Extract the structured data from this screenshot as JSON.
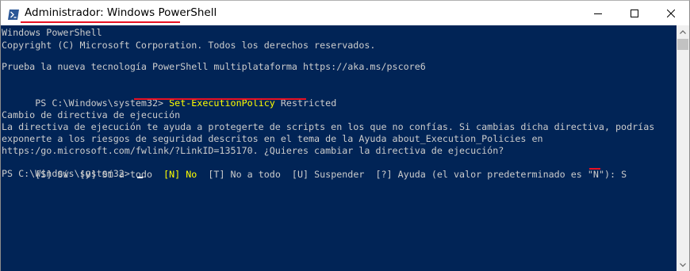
{
  "window": {
    "title": "Administrador: Windows PowerShell",
    "icon": "powershell-icon",
    "controls": [
      "minimize-icon",
      "maximize-icon",
      "close-icon"
    ]
  },
  "console": {
    "lines": [
      "Windows PowerShell",
      "Copyright (C) Microsoft Corporation. Todos los derechos reservados.",
      "",
      "Prueba la nueva tecnología PowerShell multiplataforma https://aka.ms/pscore6",
      "",
      "PS C:\\Windows\\system32> ",
      "",
      "Cambio de directiva de ejecución",
      "La directiva de ejecución te ayuda a protegerte de scripts en los que no confías. Si cambias dicha directiva, podrías",
      "exponerte a los riesgos de seguridad descritos en el tema de la Ayuda about_Execution_Policies en",
      "https:/go.microsoft.com/fwlink/?LinkID=135170. ¿Quieres cambiar la directiva de ejecución?",
      "",
      "PS C:\\Windows\\system32> "
    ],
    "command": {
      "cmdlet": "Set-ExecutionPolicy",
      "argument": " Restricted"
    },
    "choice_prompt": {
      "before": "[S] Sí  [O] Sí a todo  ",
      "highlighted": "[N] No",
      "after": "  [T] No a todo  [U] Suspender  [?] Ayuda (el valor predeterminado es \"N\"): ",
      "answer": "S"
    }
  },
  "colors": {
    "console_background": "#012456",
    "console_text": "#cccccc",
    "highlight_text": "#ffff00",
    "annotation_red": "#e81123"
  }
}
